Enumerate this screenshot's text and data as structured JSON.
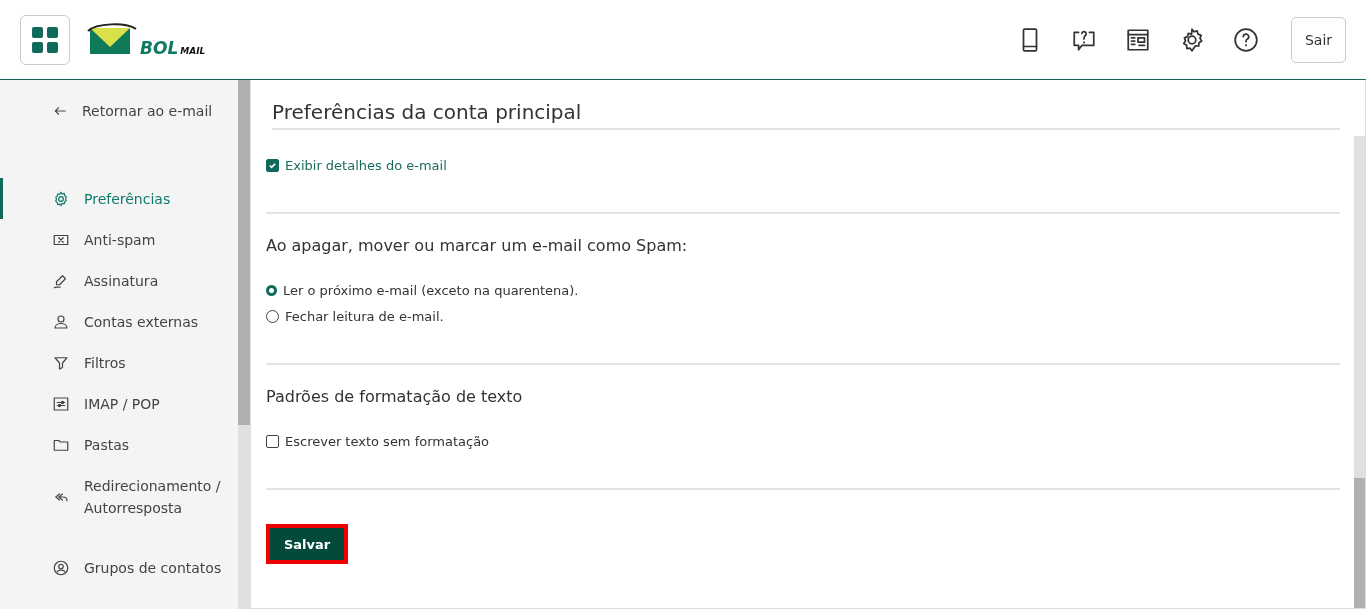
{
  "header": {
    "logo": {
      "main": "BOL",
      "sub": "MAIL"
    },
    "logout_button": "Sair"
  },
  "sidebar": {
    "back_link": "Retornar ao e-mail",
    "items": [
      {
        "label": "Preferências",
        "selected": true
      },
      {
        "label": "Anti-spam",
        "selected": false
      },
      {
        "label": "Assinatura",
        "selected": false
      },
      {
        "label": "Contas externas",
        "selected": false
      },
      {
        "label": "Filtros",
        "selected": false
      },
      {
        "label": "IMAP / POP",
        "selected": false
      },
      {
        "label": "Pastas",
        "selected": false
      },
      {
        "label": "Redirecionamento / Autorresposta",
        "selected": false
      },
      {
        "label": "Grupos de contatos",
        "selected": false
      }
    ]
  },
  "main": {
    "title": "Preferências da conta principal",
    "sections": [
      {
        "options": [
          {
            "kind": "checkbox",
            "label": "Exibir detalhes do e-mail",
            "checked": true
          }
        ]
      },
      {
        "heading": "Ao apagar, mover ou marcar um e-mail como Spam:",
        "options": [
          {
            "kind": "radio",
            "label": "Ler o próximo e-mail (exceto na quarentena).",
            "selected": true
          },
          {
            "kind": "radio",
            "label": "Fechar leitura de e-mail.",
            "selected": false
          }
        ]
      },
      {
        "heading": "Padrões de formatação de texto",
        "options": [
          {
            "kind": "checkbox",
            "label": "Escrever texto sem formatação",
            "checked": false
          }
        ]
      }
    ],
    "save_button": "Salvar"
  }
}
